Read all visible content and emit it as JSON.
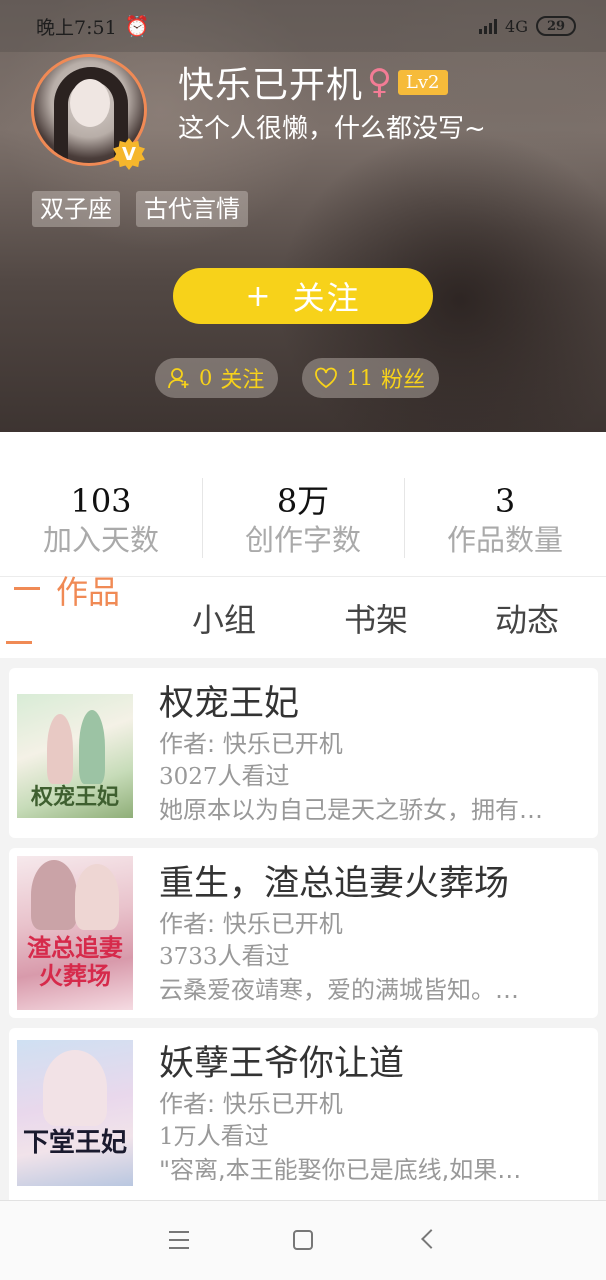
{
  "status_bar": {
    "time": "晚上7:51",
    "network": "4G",
    "battery": "29"
  },
  "profile": {
    "username": "快乐已开机",
    "gender_symbol": "♀",
    "level": "Lv2",
    "verified_badge": "V",
    "bio": "这个人很懒，什么都没写~",
    "tags": [
      "双子座",
      "古代言情"
    ],
    "follow_button": "关注",
    "follow_plus": "+",
    "following_count": "0",
    "following_label": "关注",
    "fans_count": "11",
    "fans_label": "粉丝"
  },
  "stats": [
    {
      "value": "103",
      "label": "加入天数"
    },
    {
      "value": "8万",
      "label": "创作字数"
    },
    {
      "value": "3",
      "label": "作品数量"
    }
  ],
  "tabs": [
    "作品",
    "小组",
    "书架",
    "动态"
  ],
  "active_tab": "作品",
  "books": [
    {
      "title": "权宠王妃",
      "author": "作者: 快乐已开机",
      "views": "3027",
      "views_suffix": "人看过",
      "desc": "她原本以为自己是天之骄女，拥有一切…",
      "cover_text": "权宠王妃"
    },
    {
      "title": "重生，渣总追妻火葬场",
      "author": "作者: 快乐已开机",
      "views": "3733",
      "views_suffix": "人看过",
      "desc": "云桑爱夜靖寒，爱的满城皆知。…",
      "cover_text": "渣总追妻火葬场"
    },
    {
      "title": "妖孽王爷你让道",
      "author": "作者: 快乐已开机",
      "views": "1万",
      "views_suffix": "人看过",
      "desc": "\"容离,本王能娶你已是底线,如果…",
      "cover_text": "下堂王妃"
    }
  ],
  "colors": {
    "accent": "#f08a55",
    "follow_yellow": "#f7d21a",
    "level_badge": "#f6bb3a",
    "gender_pink": "#f37c95"
  }
}
